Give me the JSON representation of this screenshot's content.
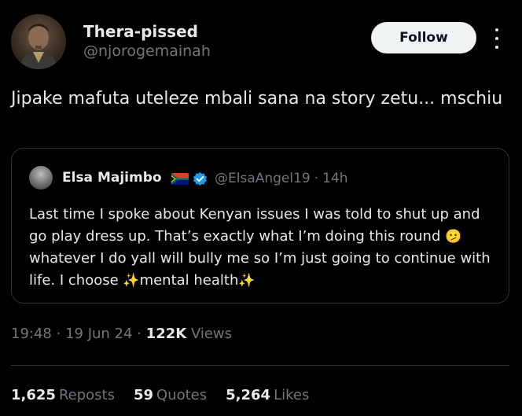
{
  "author": {
    "display_name": "Thera-pissed",
    "handle": "@njorogemainah"
  },
  "follow_label": "Follow",
  "tweet_text": "Jipake mafuta uteleze mbali sana na story zetu... mschiu",
  "quote": {
    "display_name": "Elsa Majimbo",
    "flag_icon": "south-africa-flag-icon",
    "verified_icon": "verified-badge-icon",
    "handle": "@ElsaAngel19",
    "separator": "·",
    "time": "14h",
    "text_part1": "Last time I spoke about Kenyan issues I was told to shut up and go play dress up. That’s exactly what I’m doing this round ",
    "emoji1": "🫤",
    "text_part2": " whatever I do yall will bully me so I’m just going to continue with life. I choose ",
    "emoji2": "✨",
    "text_part3": "mental health",
    "emoji3": "✨"
  },
  "meta": {
    "time": "19:48",
    "date": "19 Jun 24",
    "separator": "·",
    "views_count": "122K",
    "views_label": "Views"
  },
  "stats": {
    "reposts_count": "1,625",
    "reposts_label": "Reposts",
    "quotes_count": "59",
    "quotes_label": "Quotes",
    "likes_count": "5,264",
    "likes_label": "Likes"
  },
  "colors": {
    "background": "#000000",
    "text": "#e7e9ea",
    "muted": "#71767b",
    "border": "#2f3336",
    "verified": "#1d9bf0",
    "follow_bg": "#eff3f4"
  }
}
